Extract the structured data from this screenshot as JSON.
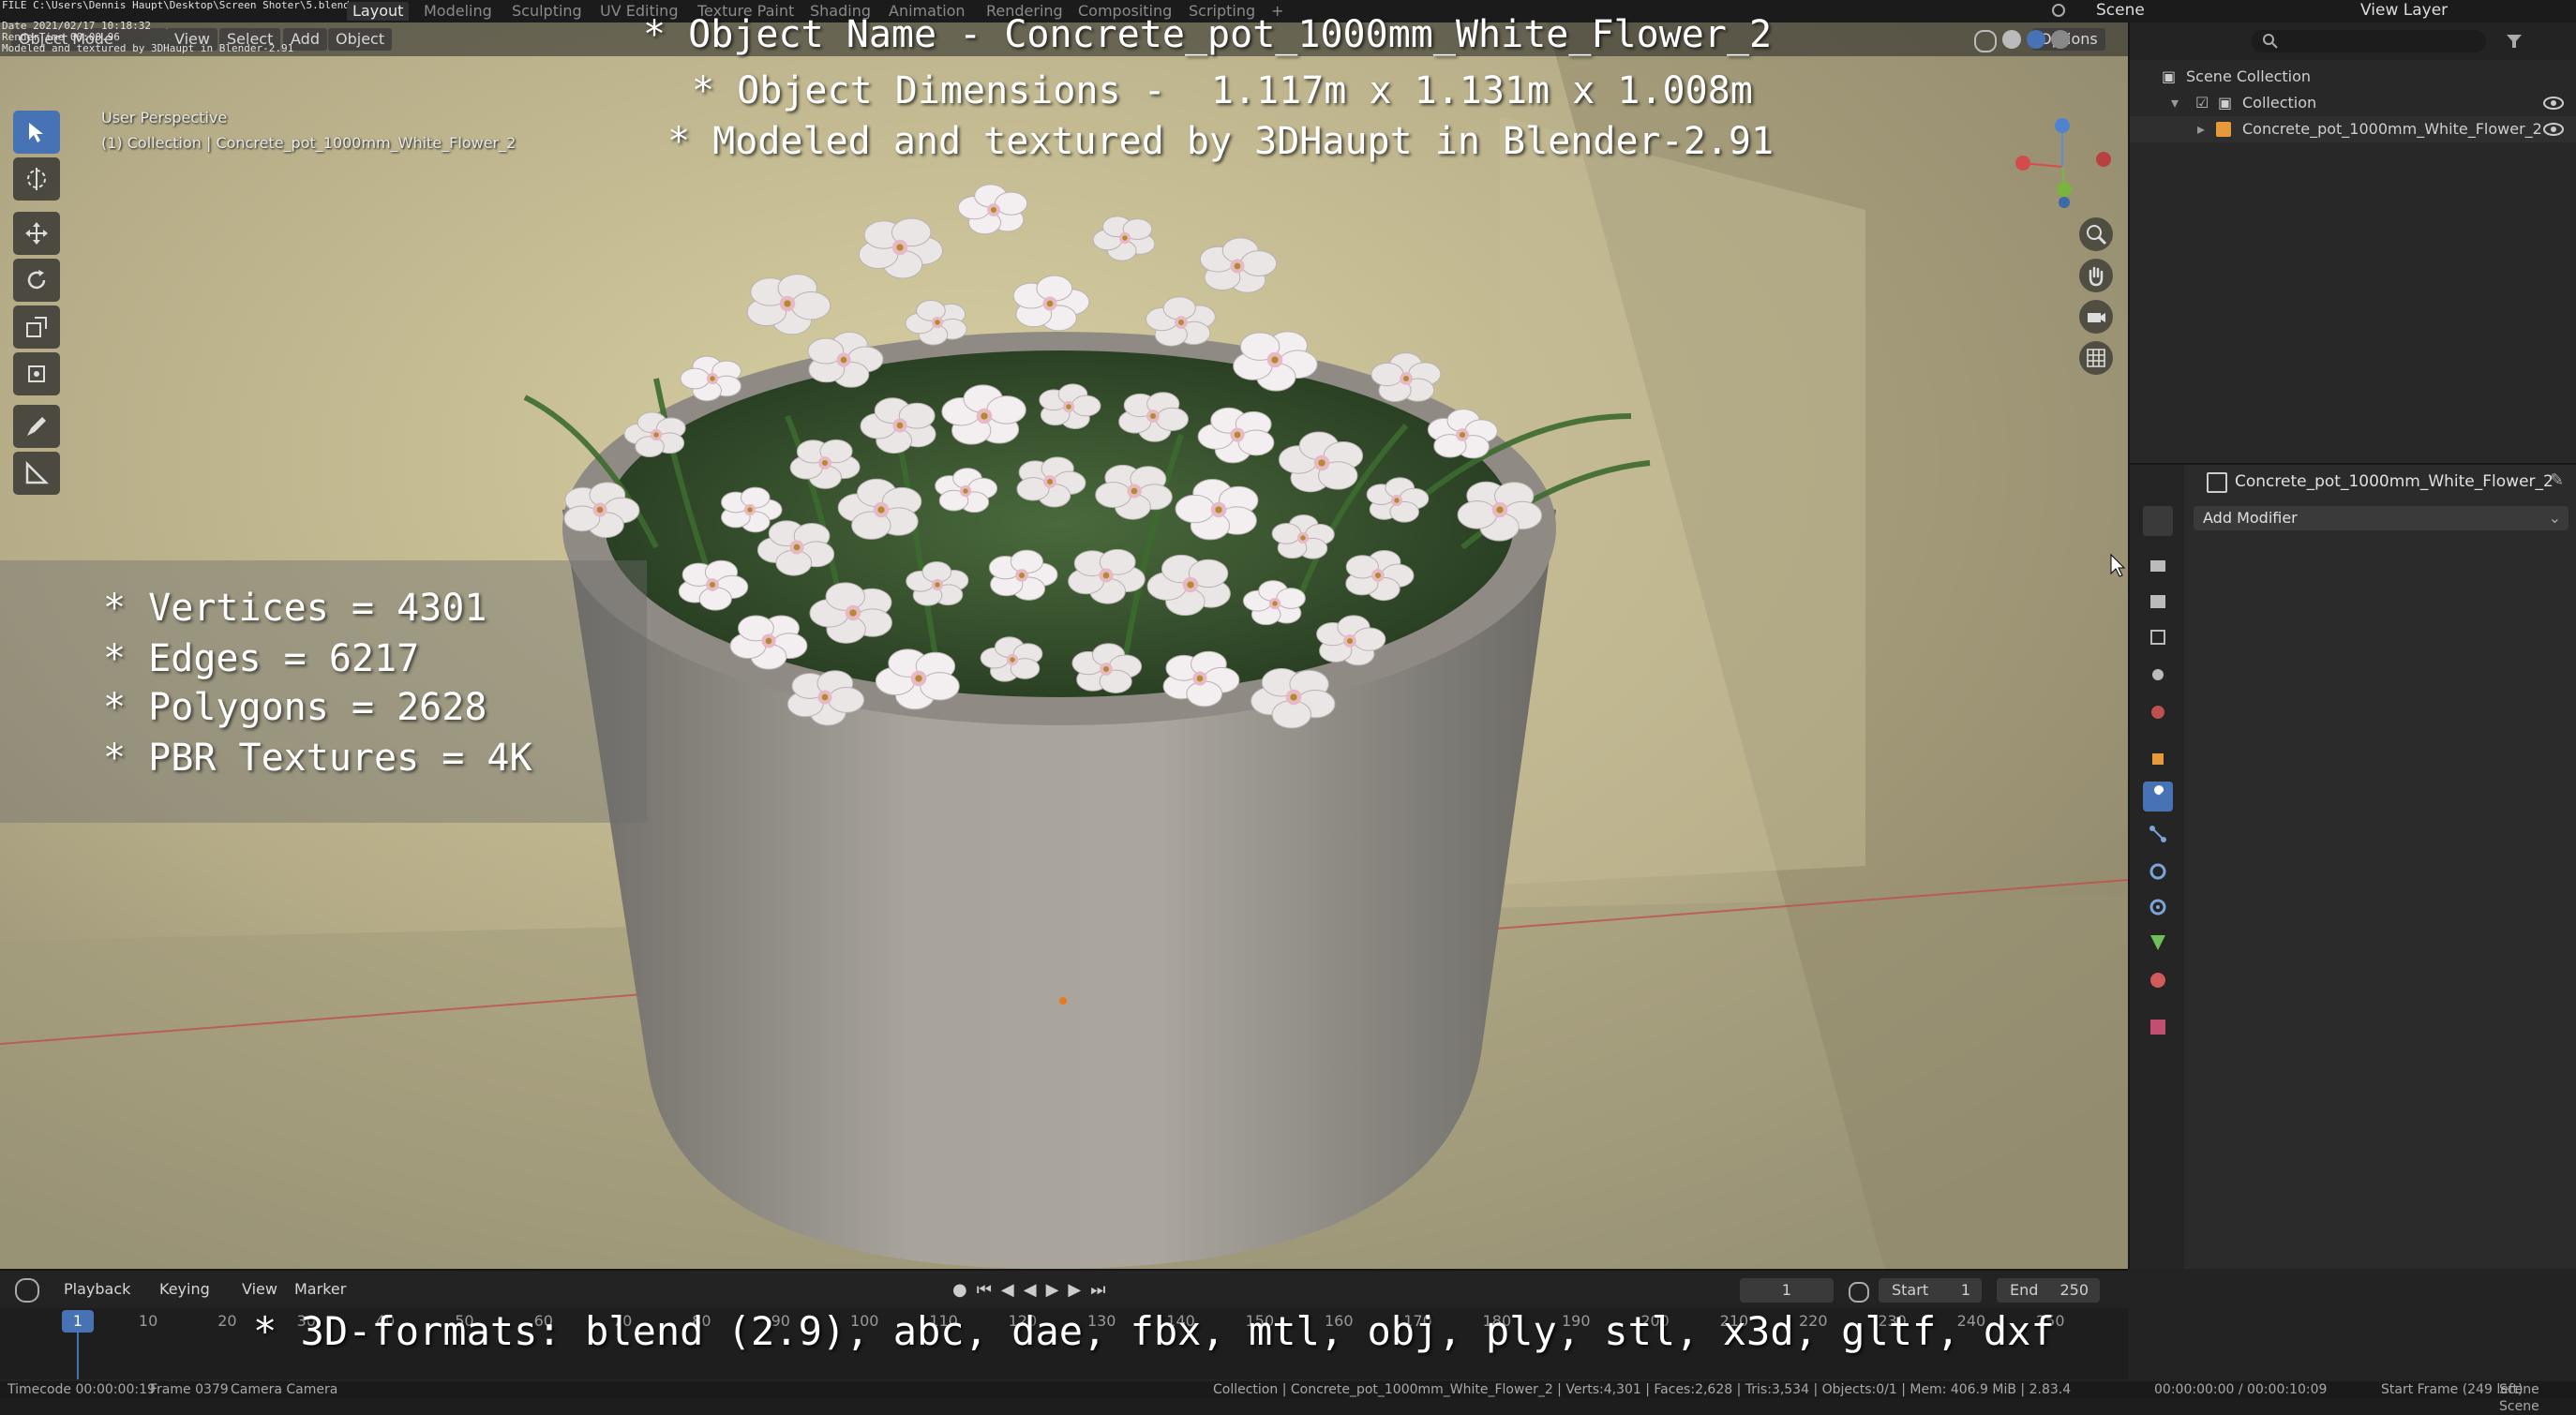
{
  "overlay_top_left": {
    "line1": "FILE C:\\Users\\Dennis Haupt\\Desktop\\Screen Shoter\\5.blend",
    "line2": "Date 2021/02/17 10:18:32",
    "line3": "RenderTime 00:00.96",
    "line4": "Modeled and textured by 3DHaupt in Blender-2.91"
  },
  "workspace_tabs": [
    "Layout",
    "Modeling",
    "Sculpting",
    "UV Editing",
    "Texture Paint",
    "Shading",
    "Animation",
    "Rendering",
    "Compositing",
    "Scripting"
  ],
  "workspace_active": "Layout",
  "scene_label": "Scene",
  "view_layer_label": "View Layer",
  "viewport": {
    "mode": "Object Mode",
    "menus": [
      "View",
      "Select",
      "Add",
      "Object"
    ],
    "options_label": "Options",
    "perspective": "User Perspective",
    "collection_info": "(1) Collection | Concrete_pot_1000mm_White_Flower_2"
  },
  "overlay": {
    "name_line": "* Object Name - Concrete_pot_1000mm_White_Flower_2",
    "dims_line": "* Object Dimensions -  1.117m x 1.131m x 1.008m",
    "credit_line": "* Modeled and textured by 3DHaupt in Blender-2.91",
    "stats": [
      "* Vertices = 4301",
      "* Edges = 6217",
      "* Polygons = 2628",
      "* PBR Textures = 4K"
    ],
    "formats": "* 3D-formats: blend (2.9), abc, dae, fbx, mtl, obj, ply, stl, x3d, gltf, dxf"
  },
  "outliner": {
    "scene_collection": "Scene Collection",
    "collection": "Collection",
    "object": "Concrete_pot_1000mm_White_Flower_2"
  },
  "properties": {
    "object_name": "Concrete_pot_1000mm_White_Flower_2",
    "add_modifier": "Add Modifier"
  },
  "timeline": {
    "menus": [
      "Playback",
      "Keying",
      "View",
      "Marker"
    ],
    "current_frame": "1",
    "start_label": "Start",
    "start_value": "1",
    "end_label": "End",
    "end_value": "250",
    "ruler": [
      "1",
      "10",
      "20",
      "30",
      "40",
      "50",
      "60",
      "70",
      "80",
      "90",
      "100",
      "110",
      "120",
      "130",
      "140",
      "150",
      "160",
      "170",
      "180",
      "190",
      "200",
      "210",
      "220",
      "230",
      "240",
      "250"
    ]
  },
  "status": {
    "timecode": "Timecode 00:00:00:19",
    "frame": "Frame 0379",
    "camera": "Camera Camera",
    "stats": "Collection | Concrete_pot_1000mm_White_Flower_2 | Verts:4,301 | Faces:2,628 | Tris:3,534 | Objects:0/1 | Mem: 406.9 MiB | 2.83.4",
    "time": "00:00:00:00 / 00:00:10:09",
    "start_frame": "Start Frame (249 left)",
    "scene_name": "Scene Scene"
  },
  "colors": {
    "accent": "#4772b3",
    "frame_marker": "#4772b3",
    "wall": "#b2a983",
    "pot": "#9a958c"
  },
  "icons": [
    "select-box-icon",
    "cursor-icon",
    "move-icon",
    "rotate-icon",
    "scale-icon",
    "transform-icon",
    "annotate-icon",
    "measure-icon",
    "zoom-icon",
    "hand-icon",
    "camera-icon",
    "grid-icon",
    "eye-icon",
    "wrench-icon"
  ]
}
